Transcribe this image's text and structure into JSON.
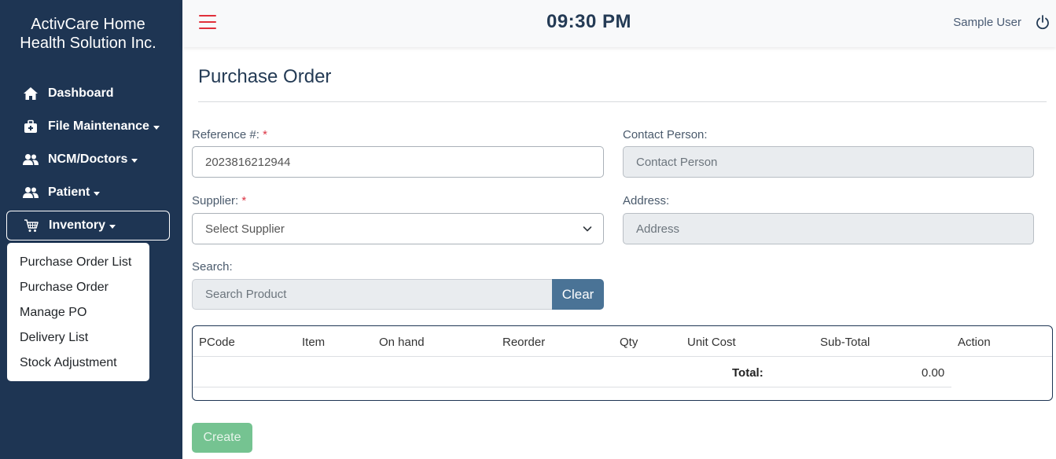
{
  "sidebar": {
    "brand_line1": "ActivCare Home",
    "brand_line2": "Health Solution Inc.",
    "items": [
      {
        "label": "Dashboard",
        "icon": "home-icon"
      },
      {
        "label": "File Maintenance",
        "icon": "medical-bag-icon"
      },
      {
        "label": "NCM/Doctors",
        "icon": "users-icon"
      },
      {
        "label": "Patient",
        "icon": "users-icon"
      },
      {
        "label": "Inventory",
        "icon": "cart-icon"
      }
    ],
    "inventory_menu": [
      "Purchase Order List",
      "Purchase Order",
      "Manage PO",
      "Delivery List",
      "Stock Adjustment"
    ]
  },
  "topbar": {
    "time": "09:30 PM",
    "user": "Sample User"
  },
  "page": {
    "title": "Purchase Order"
  },
  "form": {
    "reference_label": "Reference #:",
    "reference_value": "2023816212944",
    "required_mark": "*",
    "contact_label": "Contact Person:",
    "contact_placeholder": "Contact Person",
    "supplier_label": "Supplier:",
    "supplier_selected": "Select Supplier",
    "address_label": "Address:",
    "address_placeholder": "Address",
    "search_label": "Search:",
    "search_placeholder": "Search Product",
    "clear_label": "Clear"
  },
  "table": {
    "columns": [
      "PCode",
      "Item",
      "On hand",
      "Reorder",
      "Qty",
      "Unit Cost",
      "Sub-Total",
      "Action"
    ],
    "total_label": "Total:",
    "total_value": "0.00"
  },
  "actions": {
    "create_label": "Create"
  },
  "colors": {
    "sidebar_bg": "#1e3553",
    "accent_red": "#e0303a",
    "clear_btn": "#4a7396",
    "create_btn": "#75c391"
  }
}
